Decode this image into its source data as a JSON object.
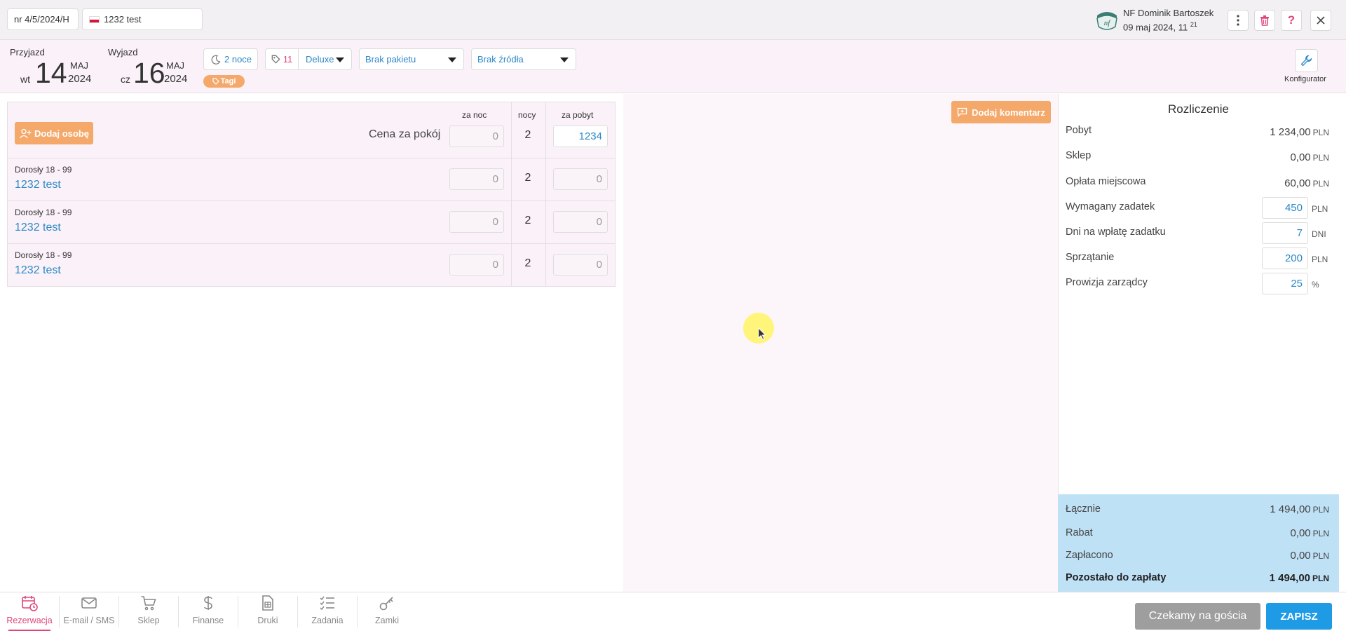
{
  "header": {
    "reservation_number": "nr 4/5/2024/H",
    "guest_name": "1232 test",
    "user_name": "NF Dominik Bartoszek",
    "date_main": "09 maj 2024, 11",
    "date_sup": "21"
  },
  "dates": {
    "arrival_label": "Przyjazd",
    "arrival_day": "wt",
    "arrival_num": "14",
    "arrival_month": "MAJ",
    "arrival_year": "2024",
    "departure_label": "Wyjazd",
    "departure_day": "cz",
    "departure_num": "16",
    "departure_month": "MAJ",
    "departure_year": "2024"
  },
  "controls": {
    "nights": "2 noce",
    "room_number": "11",
    "room_type": "Deluxe",
    "package": "Brak pakietu",
    "source": "Brak źródła",
    "tags": "Tagi",
    "configurator": "Konfigurator"
  },
  "table": {
    "add_person": "Dodaj osobę",
    "col_per_night": "za noc",
    "col_nights": "nocy",
    "col_per_stay": "za pobyt",
    "room_price_label": "Cena za pokój",
    "room_row": {
      "per_night": "0",
      "nights": "2",
      "per_stay": "1234"
    },
    "persons": [
      {
        "category": "Dorosły 18 - 99",
        "name": "1232 test",
        "per_night": "0",
        "nights": "2",
        "per_stay": "0"
      },
      {
        "category": "Dorosły 18 - 99",
        "name": "1232 test",
        "per_night": "0",
        "nights": "2",
        "per_stay": "0"
      },
      {
        "category": "Dorosły 18 - 99",
        "name": "1232 test",
        "per_night": "0",
        "nights": "2",
        "per_stay": "0"
      }
    ]
  },
  "comment_button": "Dodaj komentarz",
  "billing": {
    "title": "Rozliczenie",
    "currency": "PLN",
    "stay_label": "Pobyt",
    "stay_value": "1 234,00",
    "shop_label": "Sklep",
    "shop_value": "0,00",
    "fee_label": "Opłata miejscowa",
    "fee_value": "60,00",
    "deposit_label": "Wymagany zadatek",
    "deposit_value": "450",
    "deposit_days_label": "Dni na wpłatę zadatku",
    "deposit_days_value": "7",
    "days_unit": "DNI",
    "cleaning_label": "Sprzątanie",
    "cleaning_value": "200",
    "commission_label": "Prowizja zarządcy",
    "commission_value": "25",
    "percent": "%",
    "total_label": "Łącznie",
    "total_value": "1 494,00",
    "discount_label": "Rabat",
    "discount_value": "0,00",
    "paid_label": "Zapłacono",
    "paid_value": "0,00",
    "remaining_label": "Pozostało do zapłaty",
    "remaining_value": "1 494,00"
  },
  "nav": {
    "items": [
      "Rezerwacja",
      "E-mail / SMS",
      "Sklep",
      "Finanse",
      "Druki",
      "Zadania",
      "Zamki"
    ]
  },
  "actions": {
    "waiting": "Czekamy na gościa",
    "save": "ZAPISZ"
  },
  "colors": {
    "accent_blue": "#2c88c7",
    "orange": "#f4a96a",
    "pink_active": "#e0457b",
    "totals_bg": "#bfe1f6"
  }
}
